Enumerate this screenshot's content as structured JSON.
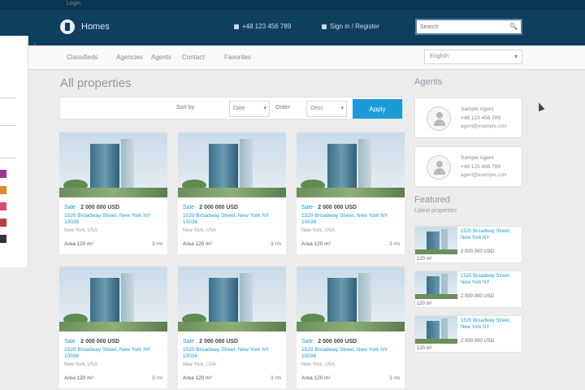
{
  "topbar": {
    "link": "Login"
  },
  "header": {
    "brand": "Homes",
    "links": [
      {
        "label": "+48 123 456 789",
        "icon": "phone-icon"
      },
      {
        "label": "Sign in / Register",
        "icon": "user-icon"
      }
    ],
    "search": {
      "placeholder": "Search",
      "icon": "search-icon"
    }
  },
  "nav": {
    "items": [
      "Classifieds",
      "Agencies",
      "Agents",
      "Contact",
      "Favorites"
    ],
    "language": "English"
  },
  "main": {
    "title": "All properties",
    "filters": {
      "sort_label": "Sort by",
      "sort_value": "Date",
      "order_label": "Order",
      "order_value": "Desc",
      "button": "Apply"
    },
    "cards": [
      {
        "tag": "Sale",
        "price": "2 000 000 USD",
        "address": "1520 Broadway Street, New York NY 10036",
        "sub": "New York, USA",
        "area": "Area 120 m²",
        "rooms": "3 rm"
      },
      {
        "tag": "Sale",
        "price": "2 000 000 USD",
        "address": "1520 Broadway Street, New York NY 10036",
        "sub": "New York, USA",
        "area": "Area 120 m²",
        "rooms": "3 rm"
      },
      {
        "tag": "Sale",
        "price": "2 000 000 USD",
        "address": "1520 Broadway Street, New York NY 10036",
        "sub": "New York, USA",
        "area": "Area 120 m²",
        "rooms": "3 rm"
      },
      {
        "tag": "Sale",
        "price": "2 000 000 USD",
        "address": "1520 Broadway Street, New York NY 10036",
        "sub": "New York, USA",
        "area": "Area 120 m²",
        "rooms": "3 rm"
      },
      {
        "tag": "Sale",
        "price": "2 000 000 USD",
        "address": "1520 Broadway Street, New York NY 10036",
        "sub": "New York, USA",
        "area": "Area 120 m²",
        "rooms": "3 rm"
      },
      {
        "tag": "Sale",
        "price": "2 000 000 USD",
        "address": "1520 Broadway Street, New York NY 10036",
        "sub": "New York, USA",
        "area": "Area 120 m²",
        "rooms": "3 rm"
      }
    ]
  },
  "sidebar": {
    "agents_title": "Agents",
    "agents": [
      {
        "name": "Sample Agent",
        "phone": "+48 123 456 789",
        "email": "agent@example.com"
      },
      {
        "name": "Sample Agent",
        "phone": "+48 123 456 789",
        "email": "agent@example.com"
      }
    ],
    "featured_title": "Featured",
    "featured_subtitle": "Latest properties",
    "featured": [
      {
        "title": "1520 Broadway Street, New York NY",
        "price": "2 000 000 USD",
        "size": "120 m²"
      },
      {
        "title": "1520 Broadway Street, New York NY",
        "price": "2 000 000 USD",
        "size": "120 m²"
      },
      {
        "title": "1520 Broadway Street, New York NY",
        "price": "2 000 000 USD",
        "size": "120 m²"
      }
    ]
  },
  "colors": {
    "header": "#0f3f5f",
    "accent": "#1a9ad6",
    "background": "#ececec"
  }
}
